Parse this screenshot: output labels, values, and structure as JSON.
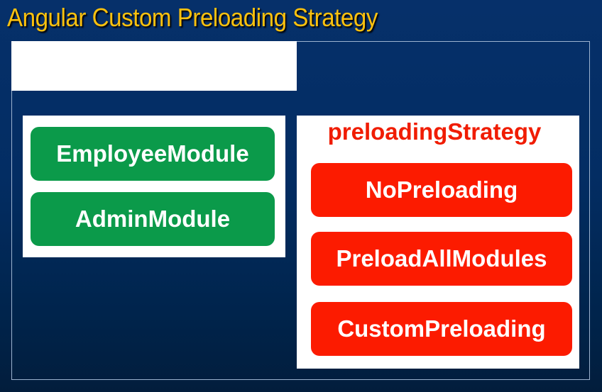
{
  "title": "Angular Custom Preloading Strategy",
  "modules": [
    "EmployeeModule",
    "AdminModule"
  ],
  "strategy": {
    "heading": "preloadingStrategy",
    "options": [
      "NoPreloading",
      "PreloadAllModules",
      "CustomPreloading"
    ]
  },
  "colors": {
    "title": "#fcc10e",
    "module": "#0b9a4a",
    "strategy": "#fc1b00",
    "background": "#03295a"
  }
}
